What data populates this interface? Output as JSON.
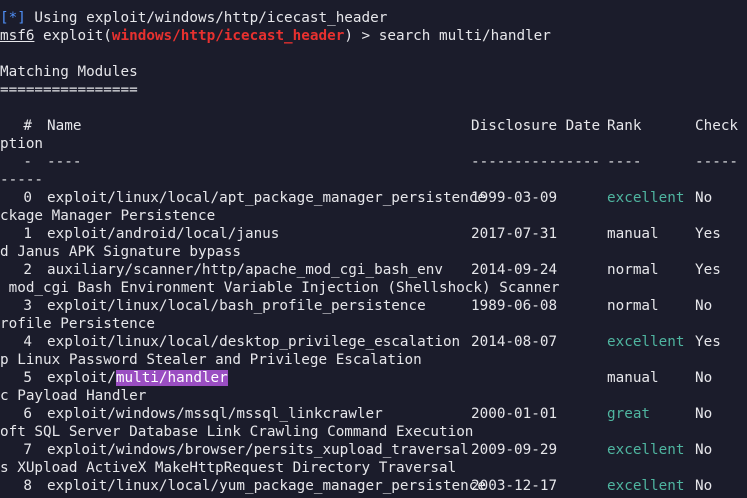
{
  "terminal": {
    "line1": {
      "bracket_open": "[",
      "star": "*",
      "bracket_close": "]",
      "text": " Using exploit/windows/http/icecast_header"
    },
    "prompt": {
      "msf": "msf6",
      "pre": " exploit(",
      "module": "windows/http/icecast_header",
      "post": ") > ",
      "command": "search multi/handler"
    },
    "heading": "Matching Modules",
    "heading_rule": "================",
    "columns": {
      "num": "#",
      "name": "Name",
      "date": "Disclosure Date",
      "rank": "Rank",
      "check": "Check",
      "desc_wrap": "ption"
    },
    "separators": {
      "num": "-",
      "name": "----",
      "date": "---------------",
      "rank": "----",
      "check": "-----",
      "desc_wrap": "-----"
    },
    "rows": [
      {
        "num": "0",
        "name": "exploit/linux/local/apt_package_manager_persistence",
        "date": "1999-03-09",
        "rank": "excellent",
        "check": "No",
        "desc": "ckage Manager Persistence"
      },
      {
        "num": "1",
        "name": "exploit/android/local/janus",
        "date": "2017-07-31",
        "rank": "manual",
        "check": "Yes",
        "desc": "d Janus APK Signature bypass"
      },
      {
        "num": "2",
        "name": "auxiliary/scanner/http/apache_mod_cgi_bash_env",
        "date": "2014-09-24",
        "rank": "normal",
        "check": "Yes",
        "desc": " mod_cgi Bash Environment Variable Injection (Shellshock) Scanner"
      },
      {
        "num": "3",
        "name": "exploit/linux/local/bash_profile_persistence",
        "date": "1989-06-08",
        "rank": "normal",
        "check": "No",
        "desc": "rofile Persistence"
      },
      {
        "num": "4",
        "name": "exploit/linux/local/desktop_privilege_escalation",
        "date": "2014-08-07",
        "rank": "excellent",
        "check": "Yes",
        "desc": "p Linux Password Stealer and Privilege Escalation"
      },
      {
        "num": "5",
        "name_pre": "exploit/",
        "name_hl": "multi/handler",
        "date": "",
        "rank": "manual",
        "check": "No",
        "desc": "c Payload Handler"
      },
      {
        "num": "6",
        "name": "exploit/windows/mssql/mssql_linkcrawler",
        "date": "2000-01-01",
        "rank": "great",
        "check": "No",
        "desc": "oft SQL Server Database Link Crawling Command Execution"
      },
      {
        "num": "7",
        "name": "exploit/windows/browser/persits_xupload_traversal",
        "date": "2009-09-29",
        "rank": "excellent",
        "check": "No",
        "desc": "s XUpload ActiveX MakeHttpRequest Directory Traversal"
      },
      {
        "num": "8",
        "name": "exploit/linux/local/yum_package_manager_persistence",
        "date": "2003-12-17",
        "rank": "excellent",
        "check": "No",
        "desc": ""
      }
    ],
    "colors": {
      "background": "#1b1c2b",
      "text": "#e6e6ea",
      "info_bracket": "#4f8ff7",
      "module_red": "#e8312f",
      "highlight": "#9a4ec2",
      "rank_good": "#4fb5a0"
    }
  }
}
